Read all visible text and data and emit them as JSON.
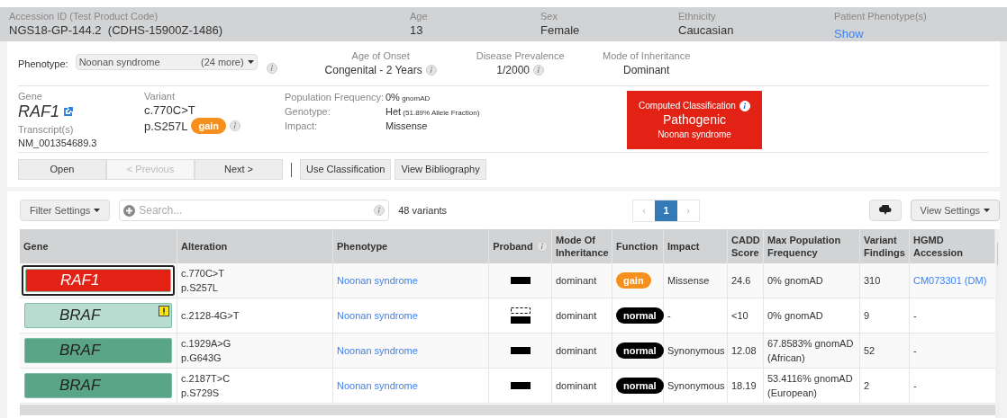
{
  "header": {
    "fields": [
      {
        "label": "Accession ID (Test Product Code)",
        "value": "NGS18-GP-144.2  (CDHS-15900Z-1486)",
        "kind": "text"
      },
      {
        "label": "Age",
        "value": "13",
        "kind": "text"
      },
      {
        "label": "Sex",
        "value": "Female",
        "kind": "text"
      },
      {
        "label": "Ethnicity",
        "value": "Caucasian",
        "kind": "text"
      },
      {
        "label": "Patient Phenotype(s)",
        "value": "Show",
        "kind": "link"
      }
    ]
  },
  "phenotype": {
    "label": "Phenotype:",
    "value": "Noonan syndrome",
    "more": "(24 more)"
  },
  "disease": [
    {
      "label": "Age of Onset",
      "value": "Congenital - 2 Years",
      "info": true
    },
    {
      "label": "Disease Prevalence",
      "value": "1/2000",
      "info": true
    },
    {
      "label": "Mode of Inheritance",
      "value": "Dominant",
      "info": false
    }
  ],
  "variant": {
    "gene_label": "Gene",
    "gene": "RAF1",
    "transcript_label": "Transcript(s)",
    "transcript": "NM_001354689.3",
    "variant_label": "Variant",
    "cdna": "c.770C>T",
    "protein": "p.S257L",
    "function": "gain",
    "details": [
      {
        "label": "Population Frequency:",
        "value": "0%",
        "note": "gnomAD"
      },
      {
        "label": "Genotype:",
        "value": "Het",
        "note": "(51.89% Allele Fraction)"
      },
      {
        "label": "Impact:",
        "value": "Missense"
      }
    ]
  },
  "classification": {
    "title": "Computed Classification",
    "value": "Pathogenic",
    "phenotype": "Noonan syndrome",
    "color": "#e22214"
  },
  "nav_buttons": [
    {
      "label": "Open",
      "disabled": false
    },
    {
      "label": "< Previous",
      "disabled": true
    },
    {
      "label": "Next >",
      "disabled": false
    }
  ],
  "action_buttons": [
    "Use Classification",
    "View Bibliography"
  ],
  "toolbar": {
    "filter": "Filter Settings",
    "search_placeholder": "Search...",
    "count": "48 variants",
    "prev": "‹",
    "pages": [
      {
        "label": "1",
        "selected": true
      }
    ],
    "next": "›",
    "view": "View Settings"
  },
  "table": {
    "columns": [
      "Gene",
      "Alteration",
      "Phenotype",
      "Proband",
      "Mode Of Inheritance",
      "Function",
      "Impact",
      "CADD Score",
      "Max Population Frequency",
      "Variant Findings",
      "HGMD Accession"
    ],
    "rows": [
      {
        "selected": true,
        "gene": "RAF1",
        "color": "#e22214",
        "warning": false,
        "alteration": [
          "c.770C>T",
          "p.S257L"
        ],
        "phenotype": "Noonan syndrome",
        "proband": {
          "kind": "solid"
        },
        "mode": "dominant",
        "function": "gain",
        "impact": "Missense",
        "cadd": "24.6",
        "max_freq": [
          "0% gnomAD"
        ],
        "findings": "310",
        "hgmd": {
          "kind": "link",
          "text": "CM073301 (DM)"
        }
      },
      {
        "selected": false,
        "gene": "BRAF",
        "color": "#b9dcd0",
        "warning": true,
        "alteration": [
          "c.2128-4G>T"
        ],
        "phenotype": "Noonan syndrome",
        "proband": {
          "kind": "dashed"
        },
        "mode": "dominant",
        "function": "normal",
        "impact": "-",
        "cadd": "<10",
        "max_freq": [
          "0% gnomAD"
        ],
        "findings": "9",
        "hgmd": {
          "kind": "text",
          "text": "-"
        }
      },
      {
        "selected": false,
        "gene": "BRAF",
        "color": "#5aa488",
        "warning": false,
        "alteration": [
          "c.1929A>G",
          "p.G643G"
        ],
        "phenotype": "Noonan syndrome",
        "proband": {
          "kind": "solid"
        },
        "mode": "dominant",
        "function": "normal",
        "impact": "Synonymous",
        "cadd": "12.08",
        "max_freq": [
          "67.8583% gnomAD",
          "(African)"
        ],
        "findings": "52",
        "hgmd": {
          "kind": "text",
          "text": "-"
        }
      },
      {
        "selected": false,
        "gene": "BRAF",
        "color": "#5aa488",
        "warning": false,
        "alteration": [
          "c.2187T>C",
          "p.S729S"
        ],
        "phenotype": "Noonan syndrome",
        "proband": {
          "kind": "solid"
        },
        "mode": "dominant",
        "function": "normal",
        "impact": "Synonymous",
        "cadd": "18.19",
        "max_freq": [
          "53.4116% gnomAD",
          "(European)"
        ],
        "findings": "2",
        "hgmd": {
          "kind": "text",
          "text": "-"
        }
      }
    ]
  }
}
